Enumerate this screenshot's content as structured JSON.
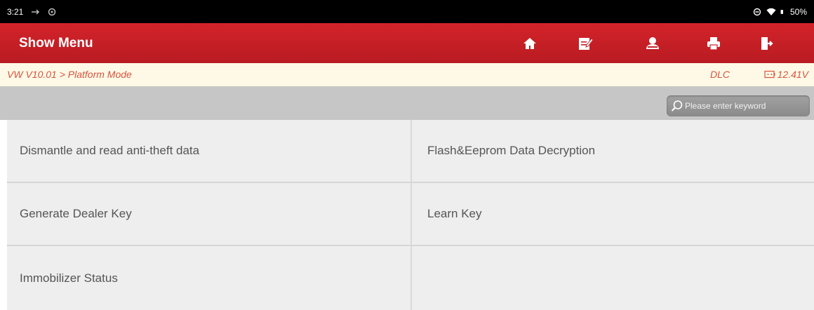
{
  "status_bar": {
    "time": "3:21",
    "battery": "50%"
  },
  "header": {
    "title": "Show Menu"
  },
  "toolbar": [
    "home-icon",
    "edit-report-icon",
    "user-icon",
    "print-icon",
    "exit-icon"
  ],
  "breadcrumb": {
    "path": "VW V10.01 > Platform Mode",
    "connection": "DLC",
    "voltage": "12.41V"
  },
  "search": {
    "placeholder": "Please enter keyword"
  },
  "menu": {
    "items": [
      "Dismantle and read anti-theft data",
      "Flash&Eeprom Data Decryption",
      "Generate Dealer Key",
      "Learn Key",
      "Immobilizer Status"
    ]
  },
  "colors": {
    "header_red": "#c8202a",
    "breadcrumb_text": "#d8533f",
    "breadcrumb_bg": "#fef9e6"
  }
}
